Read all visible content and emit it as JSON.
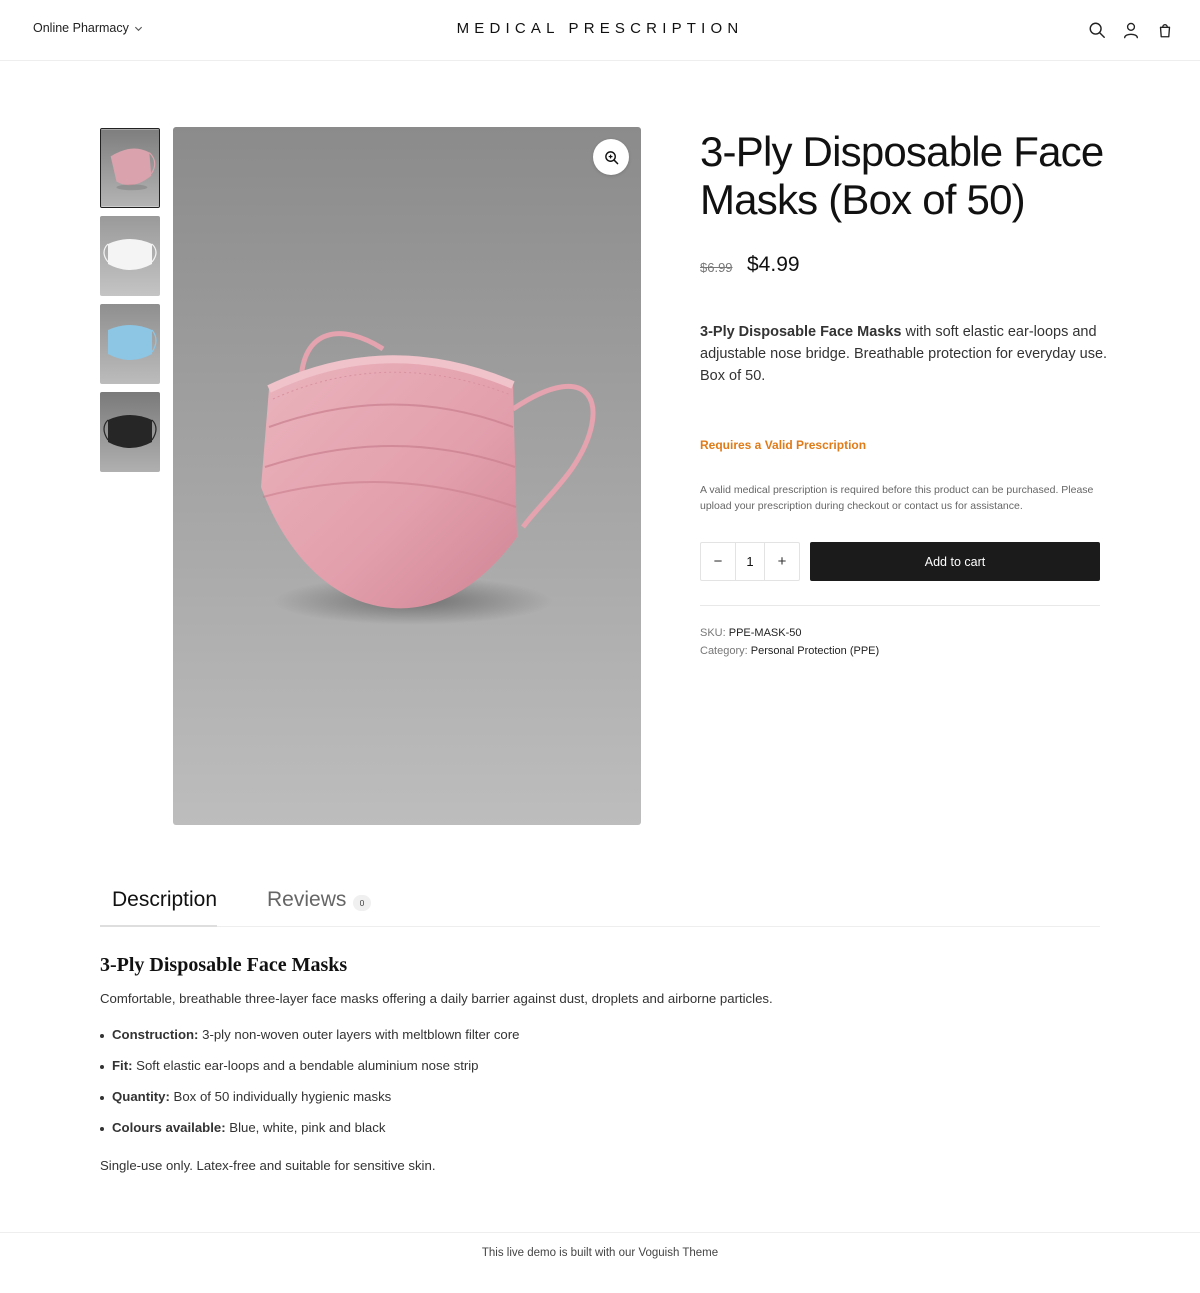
{
  "header": {
    "store_menu": "Online Pharmacy",
    "logo": "MEDICAL PRESCRIPTION",
    "icons": [
      "search-icon",
      "account-icon",
      "cart-bag-icon"
    ]
  },
  "gallery": {
    "thumbnails": [
      {
        "variant": "pink",
        "color": "#d9a2ac"
      },
      {
        "variant": "white",
        "color": "#efefef"
      },
      {
        "variant": "blue",
        "color": "#8cc6e4"
      },
      {
        "variant": "black",
        "color": "#2a2a2a"
      }
    ],
    "active_index": 0,
    "zoom_icon": "zoom-in-icon"
  },
  "product": {
    "title": "3-Ply Disposable Face Masks (Box of 50)",
    "price_old": "$6.99",
    "price_new": "$4.99",
    "short_desc_bold": "3-Ply Disposable Face Masks",
    "short_desc_rest": " with soft elastic ear-loops and adjustable nose bridge. Breathable protection for everyday use. Box of 50.",
    "prescription_title": "Requires a Valid Prescription",
    "prescription_note": "A valid medical prescription is required before this product can be purchased. Please upload your prescription during checkout or contact us for assistance.",
    "quantity": "1",
    "qty_minus": "−",
    "qty_plus": "+",
    "add_to_cart": "Add to cart",
    "sku_label": "SKU:",
    "sku_value": "PPE-MASK-50",
    "category_label": "Category:",
    "category_value": "Personal Protection (PPE)"
  },
  "tabs": {
    "description": "Description",
    "reviews": "Reviews",
    "reviews_count": "0"
  },
  "description": {
    "heading": "3-Ply Disposable Face Masks",
    "intro": "Comfortable, breathable three-layer face masks offering a daily barrier against dust, droplets and airborne particles.",
    "features": [
      {
        "label": "Construction:",
        "text": " 3-ply non-woven outer layers with meltblown filter core"
      },
      {
        "label": "Fit:",
        "text": " Soft elastic ear-loops and a bendable aluminium nose strip"
      },
      {
        "label": "Quantity:",
        "text": " Box of 50 individually hygienic masks"
      },
      {
        "label": "Colours available:",
        "text": " Blue, white, pink and black"
      }
    ],
    "outro": "Single-use only. Latex-free and suitable for sensitive skin."
  },
  "footer": {
    "text": "This live demo is built with our",
    "link": "Voguish Theme"
  },
  "colors": {
    "accent_orange": "#e07b18",
    "button_dark": "#1b1b1b",
    "mask_pink": "#e4a3ae"
  }
}
